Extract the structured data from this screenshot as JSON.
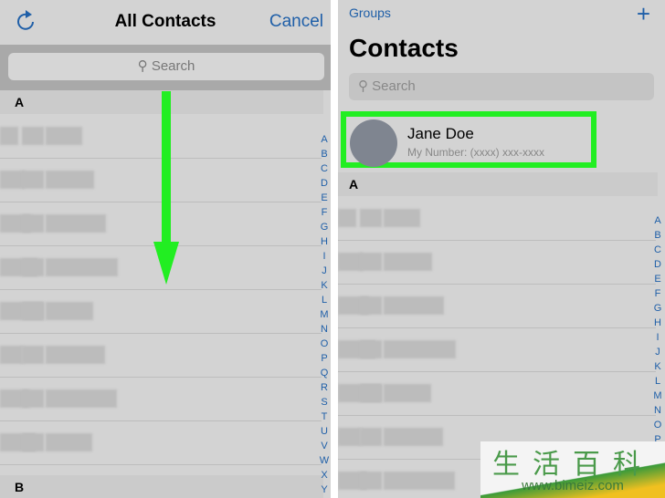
{
  "left": {
    "title": "All Contacts",
    "cancel": "Cancel",
    "refresh_icon": "refresh-icon",
    "search_placeholder": "Search",
    "sections": [
      "A",
      "B"
    ],
    "index": [
      "A",
      "B",
      "C",
      "D",
      "E",
      "F",
      "G",
      "H",
      "I",
      "J",
      "K",
      "L",
      "M",
      "N",
      "O",
      "P",
      "Q",
      "R",
      "S",
      "T",
      "U",
      "V",
      "W",
      "X",
      "Y"
    ]
  },
  "right": {
    "groups": "Groups",
    "add_icon": "plus-icon",
    "title": "Contacts",
    "search_placeholder": "Search",
    "my_card": {
      "name": "Jane Doe",
      "subtitle": "My Number: (xxxx) xxx-xxxx"
    },
    "section": "A",
    "index": [
      "A",
      "B",
      "C",
      "D",
      "E",
      "F",
      "G",
      "H",
      "I",
      "J",
      "K",
      "L",
      "M",
      "N",
      "O",
      "P"
    ]
  },
  "annotation": {
    "arrow_color": "#22ee22",
    "highlight_color": "#22ee22"
  },
  "watermark": {
    "text": "生活百科",
    "url": "www.bimeiz.com"
  }
}
